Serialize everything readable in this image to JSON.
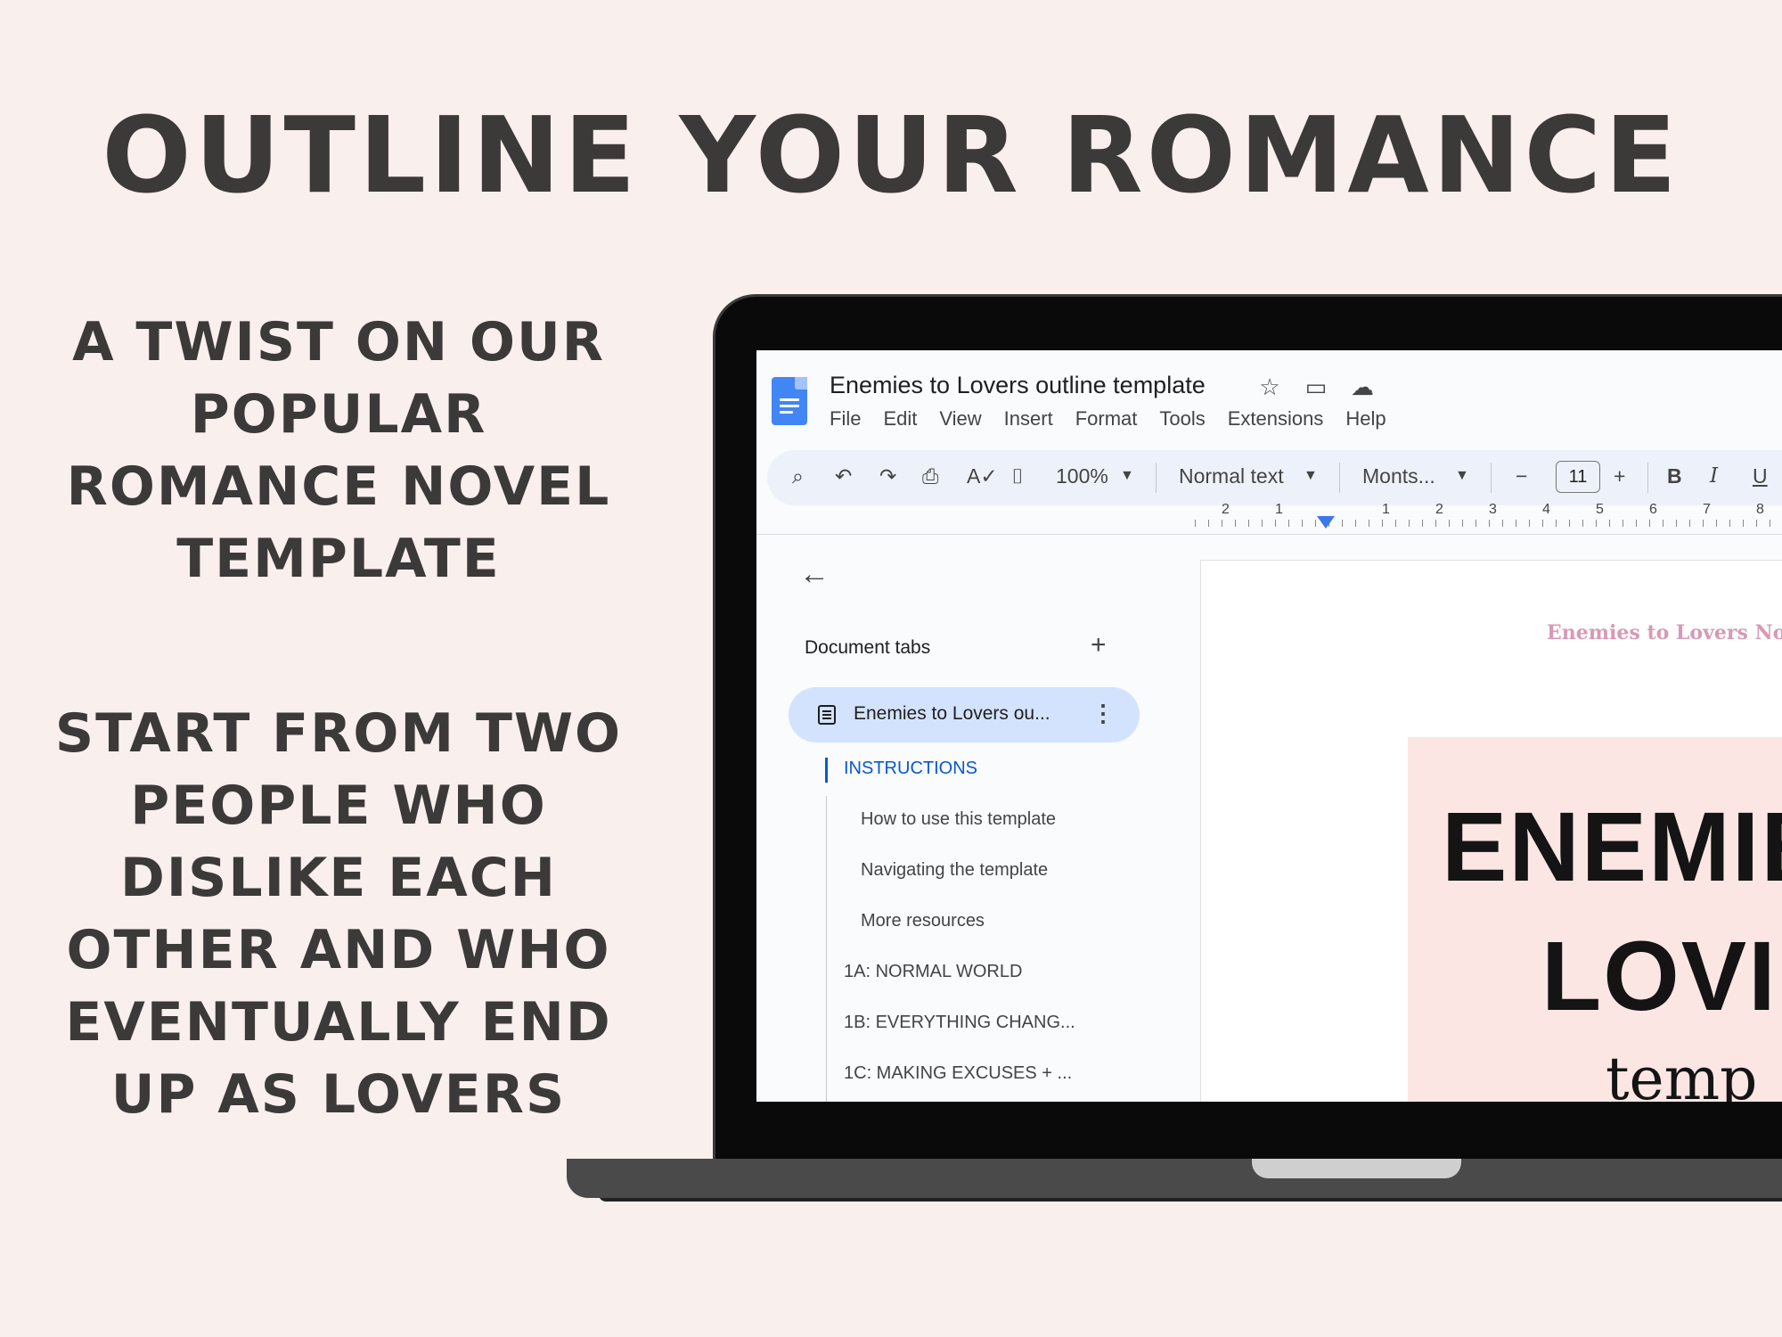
{
  "headline": "OUTLINE YOUR ROMANCE",
  "side_block_1": [
    "A TWIST ON OUR",
    "POPULAR",
    "ROMANCE NOVEL",
    "TEMPLATE"
  ],
  "side_block_2": [
    "START FROM TWO",
    "PEOPLE WHO",
    "DISLIKE EACH",
    "OTHER AND WHO",
    "EVENTUALLY END",
    "UP AS LOVERS"
  ],
  "app": {
    "title": "Enemies to Lovers outline template",
    "title_icons": [
      "star-icon",
      "move-folder-icon",
      "cloud-status-icon"
    ],
    "menu": [
      "File",
      "Edit",
      "View",
      "Insert",
      "Format",
      "Tools",
      "Extensions",
      "Help"
    ]
  },
  "toolbar": {
    "zoom": "100%",
    "style": "Normal text",
    "font": "Monts...",
    "font_size": "11",
    "minus": "−",
    "plus": "+",
    "bold": "B",
    "italic": "I",
    "underline": "U"
  },
  "ruler": [
    "2",
    "1",
    "1",
    "2",
    "3",
    "4",
    "5",
    "6",
    "7",
    "8"
  ],
  "sidebar": {
    "tabs_label": "Document tabs",
    "add": "+",
    "active_tab": "Enemies to Lovers ou...",
    "outline": [
      {
        "label": "INSTRUCTIONS",
        "level": 1,
        "active": true
      },
      {
        "label": "How to use this template",
        "level": 2
      },
      {
        "label": "Navigating the template",
        "level": 2
      },
      {
        "label": "More resources",
        "level": 2
      },
      {
        "label": "1A: NORMAL WORLD",
        "level": 1
      },
      {
        "label": "1B: EVERYTHING CHANG...",
        "level": 1
      },
      {
        "label": "1C: MAKING EXCUSES + ...",
        "level": 1
      }
    ]
  },
  "document": {
    "header": "Enemies to Lovers Nove",
    "cover_line1": "ENEMIE",
    "cover_line2": "LOVI",
    "cover_line3": "temp"
  },
  "colors": {
    "background": "#f9efed",
    "text": "#3c3a38",
    "docs_blue": "#4285f4",
    "active_tab": "#d3e3fd",
    "cover_pink": "#fbe6e3",
    "header_pink": "#d79ab4"
  }
}
